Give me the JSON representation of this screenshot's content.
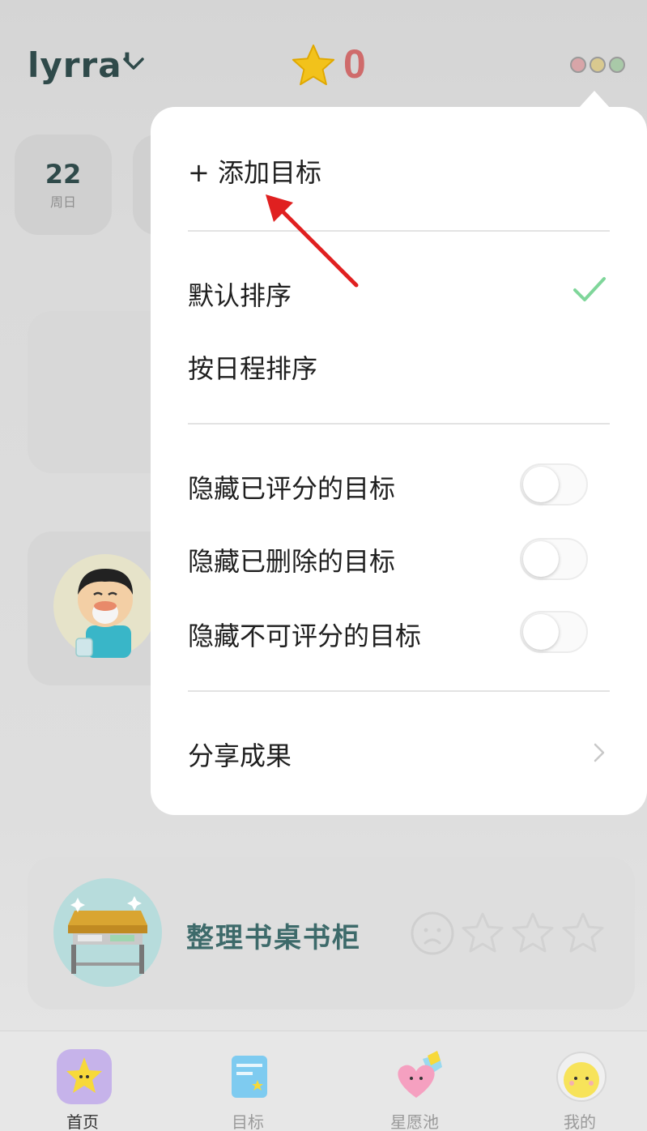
{
  "header": {
    "username": "lyrra'",
    "star_count": "0"
  },
  "date_strip": {
    "day": "22",
    "weekday": "周日"
  },
  "task": {
    "title": "整理书桌书柜"
  },
  "menu": {
    "add_goal": "+ 添加目标",
    "sort_default": "默认排序",
    "sort_schedule": "按日程排序",
    "hide_rated": "隐藏已评分的目标",
    "hide_deleted": "隐藏已删除的目标",
    "hide_unratable": "隐藏不可评分的目标",
    "share": "分享成果",
    "hide_rated_on": false,
    "hide_deleted_on": false,
    "hide_unratable_on": false
  },
  "tabs": [
    {
      "label": "首页",
      "icon": "home-star-icon"
    },
    {
      "label": "目标",
      "icon": "goal-card-icon"
    },
    {
      "label": "星愿池",
      "icon": "heart-wish-icon"
    },
    {
      "label": "我的",
      "icon": "profile-face-icon"
    }
  ],
  "colors": {
    "accent_check": "#7fd69a",
    "star": "#f2c21b",
    "star_count": "#cf6b6b",
    "title_teal": "#3d6a6a",
    "annotation_arrow": "#e02020"
  }
}
